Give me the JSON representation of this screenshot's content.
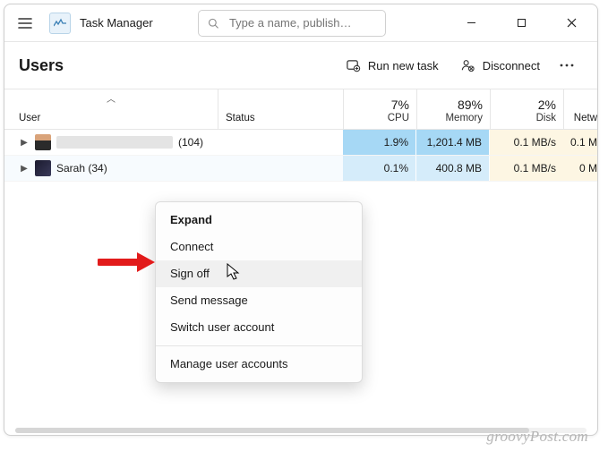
{
  "app": {
    "title": "Task Manager",
    "search_placeholder": "Type a name, publish…"
  },
  "page": {
    "title": "Users",
    "run_new_task": "Run new task",
    "disconnect": "Disconnect"
  },
  "columns": {
    "user": "User",
    "status": "Status",
    "cpu_pct": "7%",
    "cpu_label": "CPU",
    "memory_pct": "89%",
    "memory_label": "Memory",
    "disk_pct": "2%",
    "disk_label": "Disk",
    "network_label": "Netw"
  },
  "rows": [
    {
      "name_suffix": "(104)",
      "cpu": "1.9%",
      "memory": "1,201.4 MB",
      "disk": "0.1 MB/s",
      "network": "0.1 M"
    },
    {
      "name": "Sarah (34)",
      "cpu": "0.1%",
      "memory": "400.8 MB",
      "disk": "0.1 MB/s",
      "network": "0 M"
    }
  ],
  "context_menu": {
    "expand": "Expand",
    "connect": "Connect",
    "sign_off": "Sign off",
    "send_message": "Send message",
    "switch_user": "Switch user account",
    "manage": "Manage user accounts"
  },
  "watermark": "groovyPost.com"
}
